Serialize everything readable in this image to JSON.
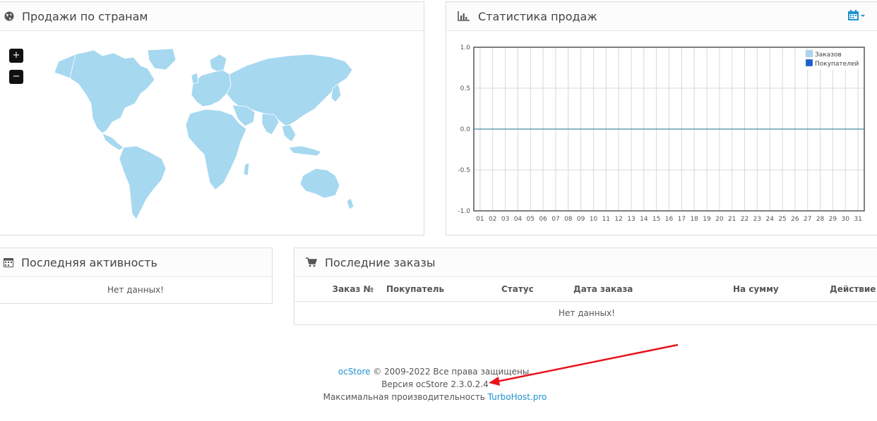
{
  "map_panel": {
    "title": "Продажи по странам",
    "zoom_in": "+",
    "zoom_out": "−",
    "icon": "globe-icon"
  },
  "stats_panel": {
    "title": "Статистика продаж",
    "icon": "bar-chart-icon",
    "calendar_icon": "calendar-icon",
    "chart_data": {
      "type": "line",
      "title": "",
      "x": [
        "01",
        "02",
        "03",
        "04",
        "05",
        "06",
        "07",
        "08",
        "09",
        "10",
        "11",
        "12",
        "13",
        "14",
        "15",
        "16",
        "17",
        "18",
        "19",
        "20",
        "21",
        "22",
        "23",
        "24",
        "25",
        "26",
        "27",
        "28",
        "29",
        "30",
        "31"
      ],
      "ylim": [
        -1.0,
        1.0
      ],
      "yticks": [
        "1.0",
        "0.5",
        "0.0",
        "-0.5",
        "-1.0"
      ],
      "series": [
        {
          "name": "Заказов",
          "color": "#a8d4f2",
          "values": [
            0,
            0,
            0,
            0,
            0,
            0,
            0,
            0,
            0,
            0,
            0,
            0,
            0,
            0,
            0,
            0,
            0,
            0,
            0,
            0,
            0,
            0,
            0,
            0,
            0,
            0,
            0,
            0,
            0,
            0,
            0
          ]
        },
        {
          "name": "Покупателей",
          "color": "#1a5fcf",
          "values": [
            0,
            0,
            0,
            0,
            0,
            0,
            0,
            0,
            0,
            0,
            0,
            0,
            0,
            0,
            0,
            0,
            0,
            0,
            0,
            0,
            0,
            0,
            0,
            0,
            0,
            0,
            0,
            0,
            0,
            0,
            0
          ]
        }
      ],
      "grid": true,
      "legend_position": "top-right"
    }
  },
  "activity_panel": {
    "title": "Последняя активность",
    "icon": "calendar-icon",
    "empty": "Нет данных!"
  },
  "orders_panel": {
    "title": "Последние заказы",
    "icon": "shopping-cart-icon",
    "columns": [
      "Заказ №",
      "Покупатель",
      "Статус",
      "Дата заказа",
      "На сумму",
      "Действие"
    ],
    "empty": "Нет данных!"
  },
  "footer": {
    "brand_link": "ocStore",
    "copyright": " © 2009-2022 Все права защищены.",
    "version": "Версия ocStore 2.3.0.2.4",
    "perf_text": "Максимальная производительность ",
    "perf_link": "TurboHost.pro"
  },
  "colors": {
    "map_fill": "#a6d8f0",
    "link": "#1e91cf",
    "annotation_arrow": "#e8141c"
  }
}
